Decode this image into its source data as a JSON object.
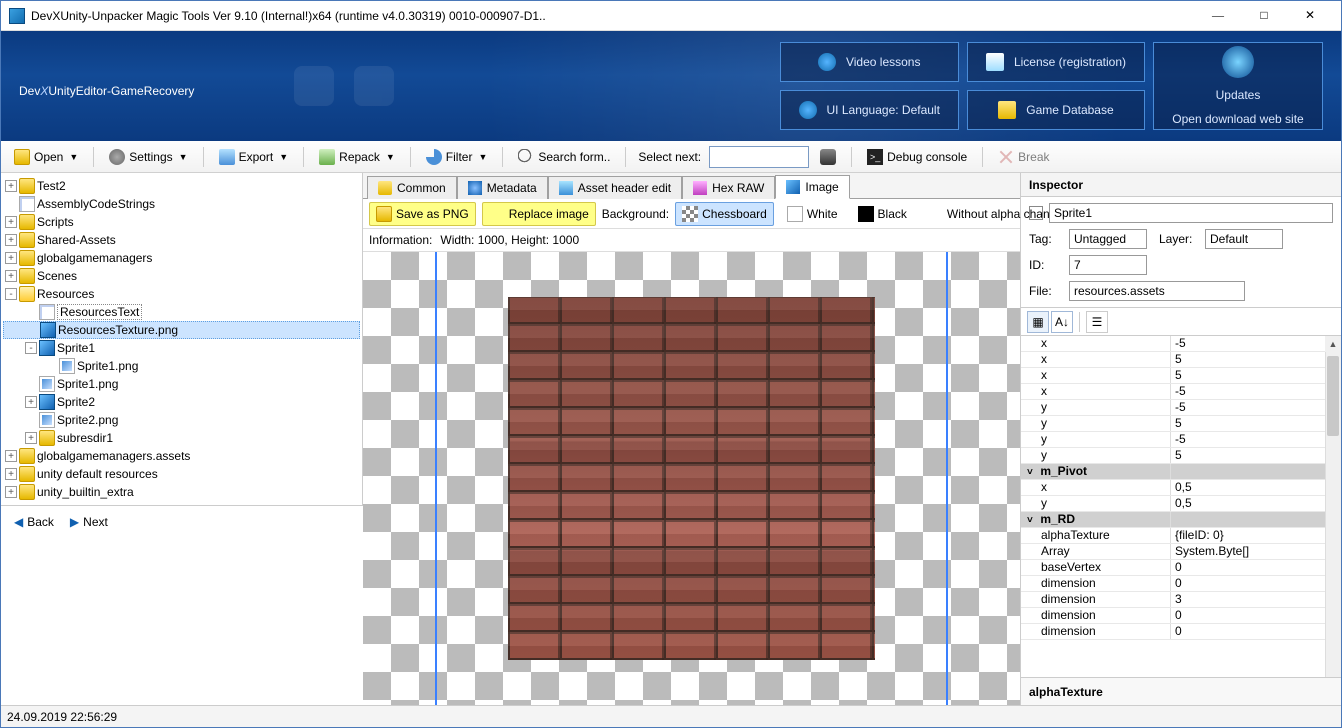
{
  "window": {
    "title": "DevXUnity-Unpacker Magic Tools Ver 9.10 (Internal!)x64 (runtime v4.0.30319) 0010-000907-D1.."
  },
  "banner": {
    "logo_pre": "Dev",
    "logo_x": "X",
    "logo_post": "UnityEditor-GameRecovery",
    "tiles": {
      "video": "Video lessons",
      "lang": "UI Language: Default",
      "license": "License (registration)",
      "db": "Game Database",
      "updates_title": "Updates",
      "updates_sub": "Open download web site"
    }
  },
  "toolbar": {
    "open": "Open",
    "settings": "Settings",
    "export": "Export",
    "repack": "Repack",
    "filter": "Filter",
    "search": "Search form..",
    "selectnext": "Select next:",
    "debug": "Debug console",
    "break": "Break"
  },
  "tree": [
    {
      "d": 0,
      "t": "+",
      "i": "folder",
      "l": "Test2"
    },
    {
      "d": 0,
      "t": "",
      "i": "txt",
      "l": "AssemblyCodeStrings"
    },
    {
      "d": 0,
      "t": "+",
      "i": "folder",
      "l": "Scripts"
    },
    {
      "d": 0,
      "t": "+",
      "i": "folder",
      "l": "Shared-Assets"
    },
    {
      "d": 0,
      "t": "+",
      "i": "folder",
      "l": "globalgamemanagers"
    },
    {
      "d": 0,
      "t": "+",
      "i": "folder",
      "l": "Scenes"
    },
    {
      "d": 0,
      "t": "-",
      "i": "folderopen",
      "l": "Resources"
    },
    {
      "d": 1,
      "t": "",
      "i": "txt",
      "l": "ResourcesText",
      "sel": false,
      "box": true
    },
    {
      "d": 1,
      "t": "",
      "i": "img",
      "l": "ResourcesTexture.png",
      "sel": true
    },
    {
      "d": 1,
      "t": "-",
      "i": "img",
      "l": "Sprite1"
    },
    {
      "d": 2,
      "t": "",
      "i": "png",
      "l": "Sprite1.png"
    },
    {
      "d": 1,
      "t": "",
      "i": "png",
      "l": "Sprite1.png"
    },
    {
      "d": 1,
      "t": "+",
      "i": "img",
      "l": "Sprite2"
    },
    {
      "d": 1,
      "t": "",
      "i": "png",
      "l": "Sprite2.png"
    },
    {
      "d": 1,
      "t": "+",
      "i": "folder",
      "l": "subresdir1"
    },
    {
      "d": 0,
      "t": "+",
      "i": "folder",
      "l": "globalgamemanagers.assets"
    },
    {
      "d": 0,
      "t": "+",
      "i": "folder",
      "l": "unity default resources"
    },
    {
      "d": 0,
      "t": "+",
      "i": "folder",
      "l": "unity_builtin_extra"
    }
  ],
  "nav": {
    "back": "Back",
    "next": "Next"
  },
  "tabs": {
    "common": "Common",
    "metadata": "Metadata",
    "header": "Asset header edit",
    "hex": "Hex RAW",
    "image": "Image"
  },
  "imgtoolbar": {
    "save": "Save as PNG",
    "replace": "Replace image",
    "bg_label": "Background:",
    "chess": "Chessboard",
    "white": "White",
    "black": "Black",
    "noalpha": "Without alpha channel"
  },
  "info": {
    "label": "Information:",
    "dims": "Width: 1000, Height: 1000"
  },
  "inspector": {
    "title": "Inspector",
    "name": "Sprite1",
    "tag_label": "Tag:",
    "tag": "Untagged",
    "layer_label": "Layer:",
    "layer": "Default",
    "id_label": "ID:",
    "id": "7",
    "file_label": "File:",
    "file": "resources.assets",
    "footer": "alphaTexture"
  },
  "props": [
    {
      "k": "x",
      "v": "-5"
    },
    {
      "k": "x",
      "v": "5"
    },
    {
      "k": "x",
      "v": "5"
    },
    {
      "k": "x",
      "v": "-5"
    },
    {
      "k": "y",
      "v": "-5"
    },
    {
      "k": "y",
      "v": "5"
    },
    {
      "k": "y",
      "v": "-5"
    },
    {
      "k": "y",
      "v": "5"
    },
    {
      "group": "m_Pivot"
    },
    {
      "k": "x",
      "v": "0,5"
    },
    {
      "k": "y",
      "v": "0,5"
    },
    {
      "group": "m_RD"
    },
    {
      "k": "alphaTexture",
      "v": "{fileID: 0}"
    },
    {
      "k": "Array",
      "v": "System.Byte[]"
    },
    {
      "k": "baseVertex",
      "v": "0"
    },
    {
      "k": "dimension",
      "v": "0"
    },
    {
      "k": "dimension",
      "v": "3"
    },
    {
      "k": "dimension",
      "v": "0"
    },
    {
      "k": "dimension",
      "v": "0"
    }
  ],
  "status": {
    "time": "24.09.2019 22:56:29"
  }
}
